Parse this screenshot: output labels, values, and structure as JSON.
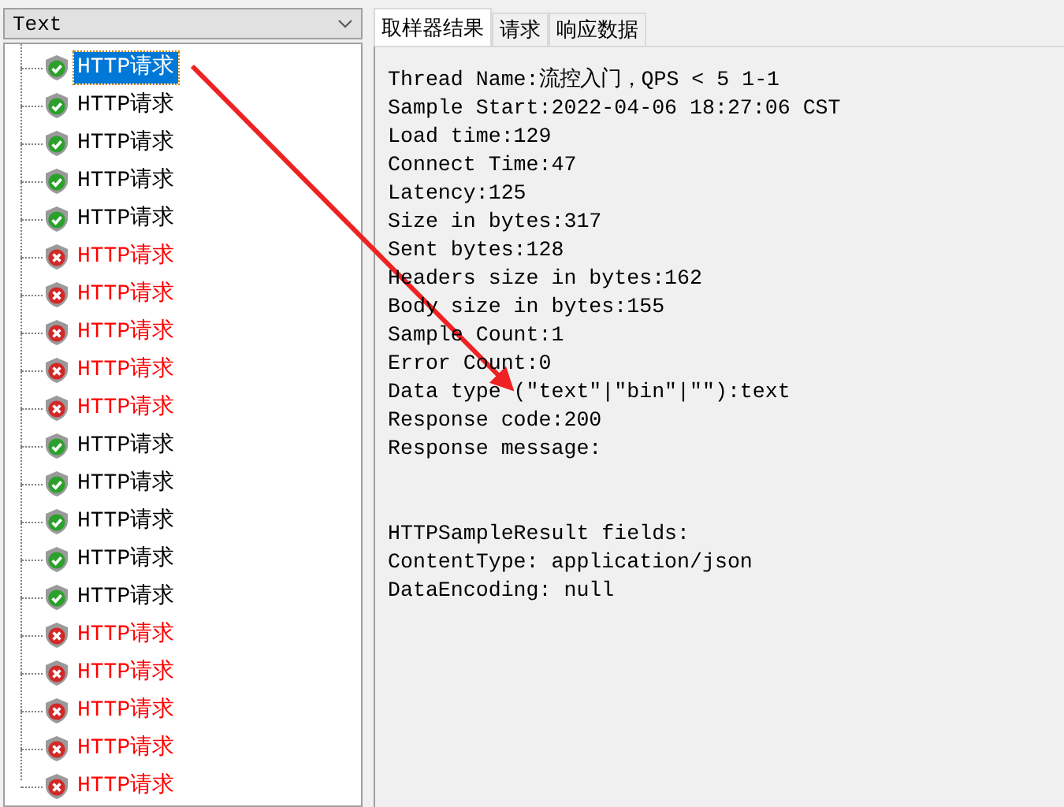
{
  "tree": {
    "filter": {
      "value": "Text"
    },
    "items": [
      {
        "label": "HTTP请求",
        "kind": "success",
        "selected": true
      },
      {
        "label": "HTTP请求",
        "kind": "success",
        "selected": false
      },
      {
        "label": "HTTP请求",
        "kind": "success",
        "selected": false
      },
      {
        "label": "HTTP请求",
        "kind": "success",
        "selected": false
      },
      {
        "label": "HTTP请求",
        "kind": "success",
        "selected": false
      },
      {
        "label": "HTTP请求",
        "kind": "error",
        "selected": false
      },
      {
        "label": "HTTP请求",
        "kind": "error",
        "selected": false
      },
      {
        "label": "HTTP请求",
        "kind": "error",
        "selected": false
      },
      {
        "label": "HTTP请求",
        "kind": "error",
        "selected": false
      },
      {
        "label": "HTTP请求",
        "kind": "error",
        "selected": false
      },
      {
        "label": "HTTP请求",
        "kind": "success",
        "selected": false
      },
      {
        "label": "HTTP请求",
        "kind": "success",
        "selected": false
      },
      {
        "label": "HTTP请求",
        "kind": "success",
        "selected": false
      },
      {
        "label": "HTTP请求",
        "kind": "success",
        "selected": false
      },
      {
        "label": "HTTP请求",
        "kind": "success",
        "selected": false
      },
      {
        "label": "HTTP请求",
        "kind": "error",
        "selected": false
      },
      {
        "label": "HTTP请求",
        "kind": "error",
        "selected": false
      },
      {
        "label": "HTTP请求",
        "kind": "error",
        "selected": false
      },
      {
        "label": "HTTP请求",
        "kind": "error",
        "selected": false
      },
      {
        "label": "HTTP请求",
        "kind": "error",
        "selected": false
      }
    ]
  },
  "tabs": [
    {
      "label": "取样器结果",
      "selected": true
    },
    {
      "label": "请求",
      "selected": false
    },
    {
      "label": "响应数据",
      "selected": false
    }
  ],
  "result_lines": [
    "Thread Name:流控入门，QPS < 5 1-1",
    "Sample Start:2022-04-06 18:27:06 CST",
    "Load time:129",
    "Connect Time:47",
    "Latency:125",
    "Size in bytes:317",
    "Sent bytes:128",
    "Headers size in bytes:162",
    "Body size in bytes:155",
    "Sample Count:1",
    "Error Count:0",
    "Data type (\"text\"|\"bin\"|\"\"):text",
    "Response code:200",
    "Response message:"
  ],
  "field_lines": [
    "HTTPSampleResult fields:",
    "ContentType: application/json",
    "DataEncoding: null"
  ]
}
